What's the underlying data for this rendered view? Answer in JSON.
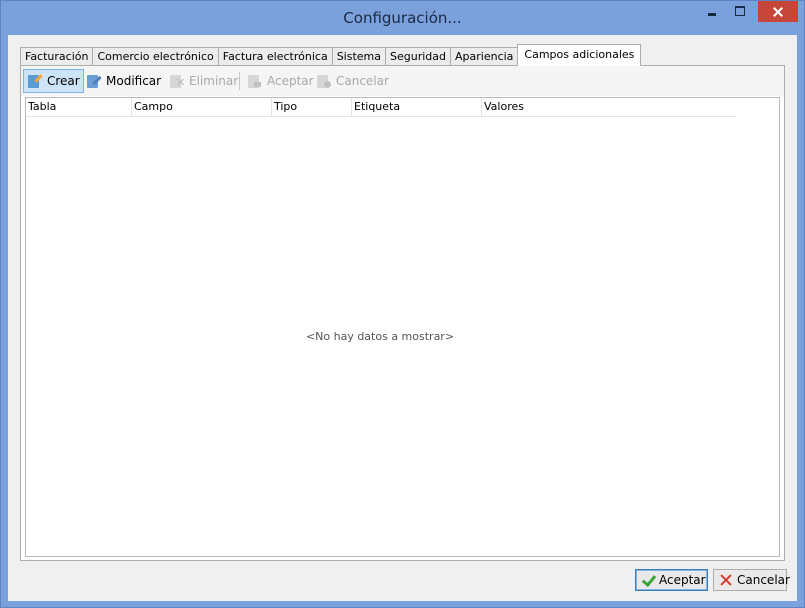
{
  "window": {
    "title": "Configuración..."
  },
  "tabs": [
    {
      "label": "Facturación"
    },
    {
      "label": "Comercio electrónico"
    },
    {
      "label": "Factura electrónica"
    },
    {
      "label": "Sistema"
    },
    {
      "label": "Seguridad"
    },
    {
      "label": "Apariencia"
    },
    {
      "label": "Campos adicionales",
      "active": true
    }
  ],
  "toolbar": {
    "create_label": "Crear",
    "modify_label": "Modificar",
    "delete_label": "Eliminar",
    "accept_label": "Aceptar",
    "cancel_label": "Cancelar"
  },
  "grid": {
    "columns": [
      "Tabla",
      "Campo",
      "Tipo",
      "Etiqueta",
      "Valores"
    ],
    "empty_text": "<No hay datos a mostrar>"
  },
  "footer": {
    "accept_label": "Aceptar",
    "cancel_label": "Cancelar"
  },
  "colors": {
    "title_bar": "#7aa1dc",
    "close_button": "#c7463a",
    "accent": "#3c7fb1"
  }
}
